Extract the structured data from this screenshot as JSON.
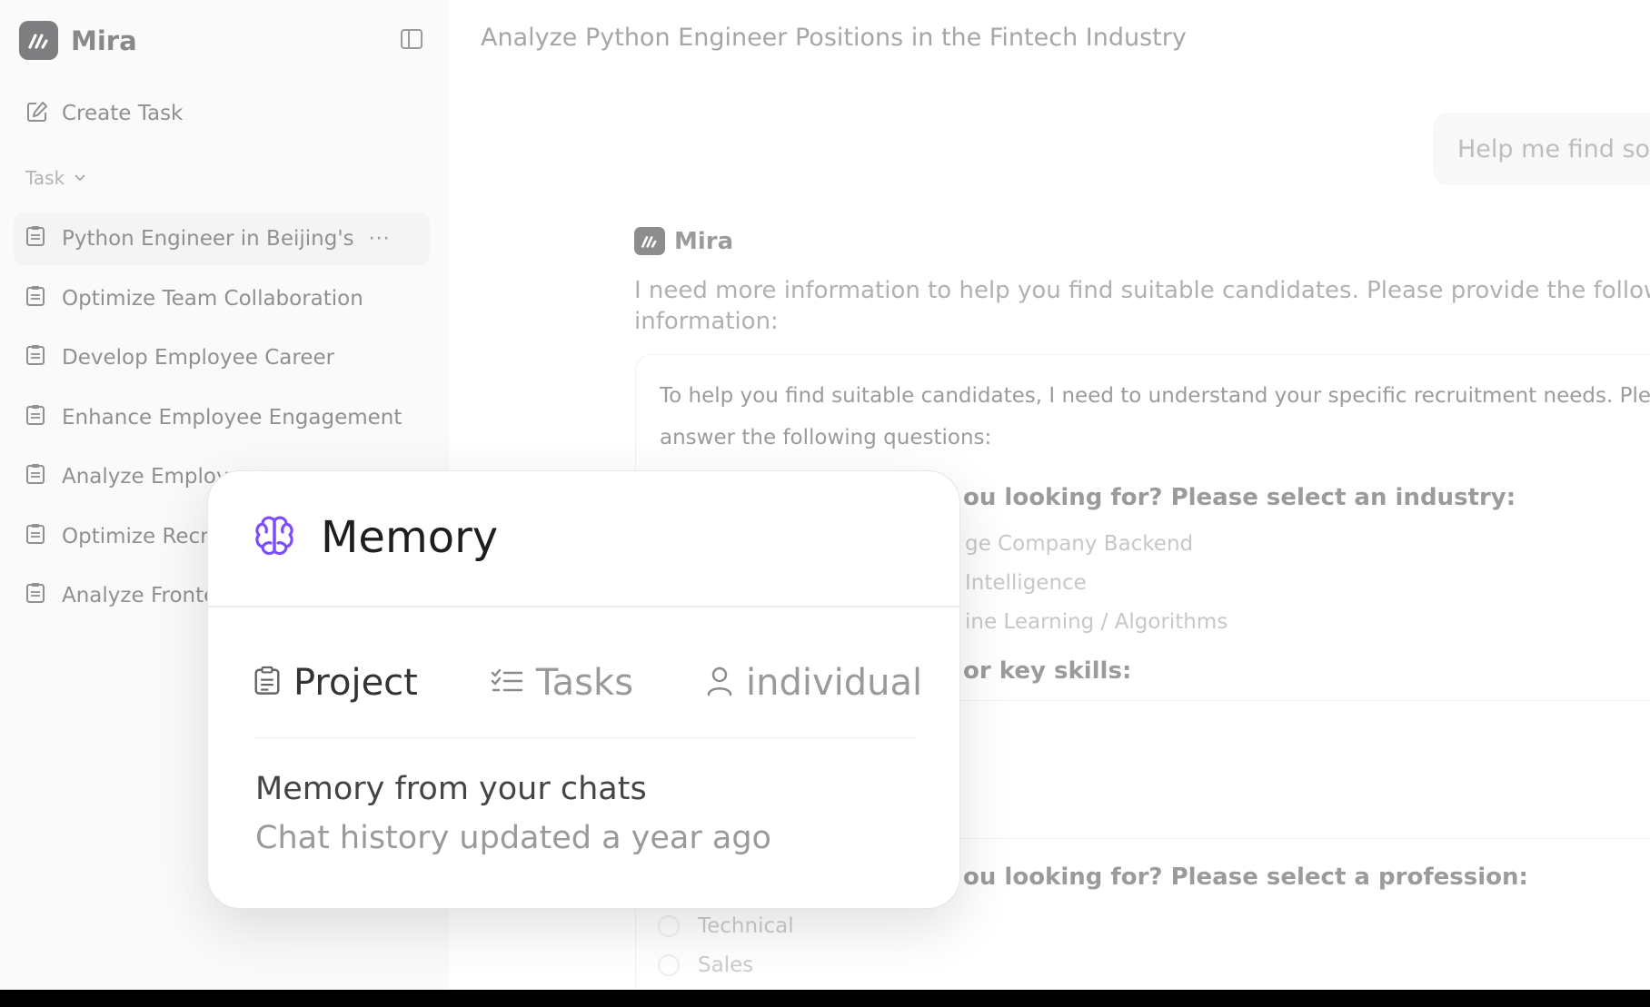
{
  "app": {
    "name": "Mira"
  },
  "sidebar": {
    "create_task_label": "Create Task",
    "section_label": "Task",
    "tasks": [
      {
        "label": "Python Engineer in Beijing's"
      },
      {
        "label": "Optimize Team Collaboration"
      },
      {
        "label": "Develop Employee Career"
      },
      {
        "label": "Enhance Employee Engagement"
      },
      {
        "label": "Analyze Employe"
      },
      {
        "label": "Optimize Recru"
      },
      {
        "label": "Analyze Fronte"
      }
    ],
    "more_label": "···"
  },
  "chat": {
    "title": "Analyze Python Engineer Positions in the Fintech Industry",
    "user_message": "Help me find some",
    "assistant_name": "Mira",
    "assistant_line1": "I need more information to help you find suitable candidates. Please provide the following k",
    "assistant_line2": "information:",
    "card": {
      "intro": "To help you find suitable candidates, I need to understand your specific recruitment needs. Please answer the following questions:",
      "q1_heading": "ou looking for? Please select an industry:",
      "q1_options": [
        "ge Company Backend",
        "Intelligence",
        "ine Learning / Algorithms"
      ],
      "q2_heading": "or key skills:",
      "q3_heading": "ou looking for? Please select a profession:",
      "q3_options": [
        "Technical",
        "Sales"
      ]
    }
  },
  "memory": {
    "title": "Memory",
    "tabs": [
      {
        "label": "Project",
        "icon": "clipboard-icon"
      },
      {
        "label": "Tasks",
        "icon": "checklist-icon"
      },
      {
        "label": "individual",
        "icon": "user-icon"
      }
    ],
    "subtitle": "Memory from your chats",
    "updated": "Chat history updated a year ago",
    "accent_color": "#7c4dff"
  }
}
